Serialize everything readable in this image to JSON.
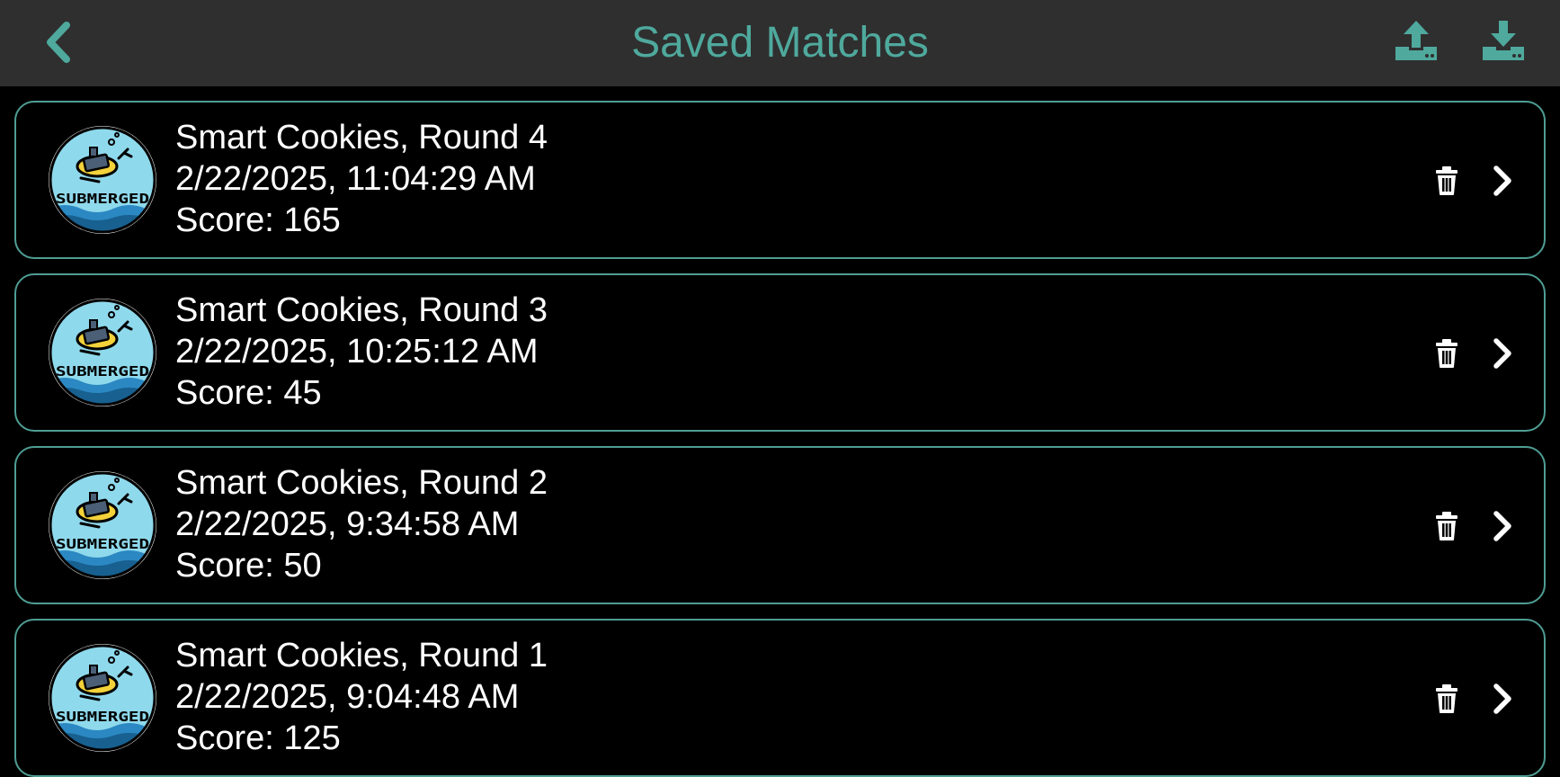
{
  "header": {
    "title": "Saved Matches",
    "accent_color": "#4fa99d",
    "back_icon": "chevron-left-icon",
    "upload_icon": "upload-icon",
    "download_icon": "download-icon"
  },
  "logo": {
    "text": "SUBMERGED"
  },
  "matches": [
    {
      "name": "Smart Cookies, Round 4",
      "datetime": "2/22/2025, 11:04:29 AM",
      "score": "Score: 165"
    },
    {
      "name": "Smart Cookies, Round 3",
      "datetime": "2/22/2025, 10:25:12 AM",
      "score": "Score: 45"
    },
    {
      "name": "Smart Cookies, Round 2",
      "datetime": "2/22/2025, 9:34:58 AM",
      "score": "Score: 50"
    },
    {
      "name": "Smart Cookies, Round 1",
      "datetime": "2/22/2025, 9:04:48 AM",
      "score": "Score: 125"
    }
  ]
}
